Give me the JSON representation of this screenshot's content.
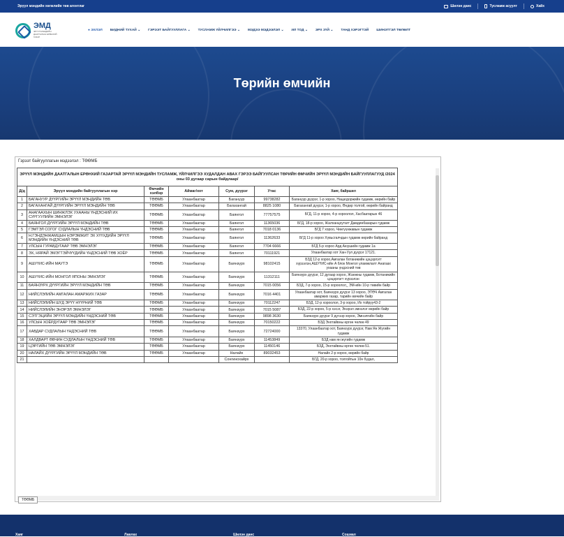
{
  "topbar": {
    "agency": "Эрүүл мэндийн хөгжлийн төв агентлаг",
    "links": [
      {
        "label": "Шилэн данс",
        "icon": "book-icon"
      },
      {
        "label": "Тусламж асуулт",
        "icon": "phone-icon"
      },
      {
        "label": "Хайх",
        "icon": "search-icon"
      }
    ]
  },
  "logo": {
    "name": "ЭМД",
    "subtitle": "ЭРҮҮЛ МЭНДИЙН ДААТГАЛЫН ЕРӨНХИЙ ГАЗАР"
  },
  "menu": [
    {
      "label": "ЭХЛЭЛ",
      "active": true
    },
    {
      "label": "БИДНИЙ ТУХАЙ ⌄"
    },
    {
      "label": "ГЭРЭЭТ БАЙГУУЛЛАГА ⌄"
    },
    {
      "label": "ТУСЛАМЖ ҮЙЛЧИЛГЭЭ ⌄"
    },
    {
      "label": "МЭДЭЭ МЭДЭЭЛЭЛ ⌄"
    },
    {
      "label": "ИЛ ТОД ⌄"
    },
    {
      "label": "ЭРХ ЗҮЙ ⌄"
    },
    {
      "label": "ТАНД ХЭРЭГТЭЙ"
    },
    {
      "label": "ШИНЭТГЭЛ ТӨЛӨЛТ"
    }
  ],
  "hero": {
    "title": "Төрийн өмчийн"
  },
  "panel": {
    "title": "Гэрээт байгууллагын мэдээлэл : ТӨӨМБ",
    "tab": "ТӨӨМБ",
    "heading_prefix": "ЭРҮҮЛ МЭНДИЙН ДААТГАЛЫН ЕРӨНХИЙ ГАЗАРТАЙ ЭРҮҮЛ МЭНДИЙН ТУСЛАМЖ, ҮЙЛЧИЛГЭЭ ХУДАЛДАН АВАХ ГЭРЭЭ БАЙГУУЛСАН ",
    "heading_bold": "ТӨРИЙН ӨМЧИЙН",
    "heading_suffix": " ЭРҮҮЛ МЭНДИЙН БАЙГУУЛЛАГУУД /2024 оны 03 дугаар сарын байдлаар/",
    "columns": [
      "Д/д",
      "Эрүүл мэндийн байгууллагын нэр",
      "Өмчийн хэлбэр",
      "Аймаг/хот",
      "Сум, дүүрэг",
      "Утас",
      "Хаяг, байршил"
    ],
    "rows": [
      [
        "1",
        "БАГАНУУР ДҮҮРГИЙН ЭРҮҮЛ МЭНДИЙН ТӨВ",
        "ТӨӨМБ",
        "Улаанбаатар",
        "Багануур",
        "99738282",
        "Багануур дүүрэг, 1-р хороо, Нацагдоржийн гудамж, өөрийн байр"
      ],
      [
        "2",
        "БАГАХАНГАЙ ДҮҮРГИЙН ЭРҮҮЛ МЭНДИЙН ТӨВ",
        "ТӨӨМБ",
        "Улаанбаатар",
        "Багахангай",
        "8825 1080",
        "Багахангай дүүрэг, 1-р хороо, Өндөр толгой, өөрийн байранд"
      ],
      [
        "3",
        "АНАГААХЫН ШИНЖЛЭХ УХААНЫ ҮНДЭСНИЙ ИХ СУРГУУЛИЙН ЭМНЭЛЭГ",
        "ТӨӨМБ",
        "Улаанбаатар",
        "Баянгол",
        "77757575",
        "БГД, 11-р хороо, 4-р хороолол, Хасбаатарын 46"
      ],
      [
        "4",
        "БАЯНГОЛ ДҮҮРГИЙН ЭРҮҮЛ МЭНДИЙН ТӨВ",
        "ТӨӨМБ",
        "Улаанбаатар",
        "Баянгол",
        "11365036",
        "БГД, 18-р хороо, Жалханцхутагт Дамдинбазарын гудамж"
      ],
      [
        "5",
        "ГЭМТЭЛ СОГОГ СУДЛАЛЫН ҮНДЭСНИЙ ТӨВ",
        "ТӨӨМБ",
        "Улаанбаатар",
        "Баянгол",
        "7018 0136",
        "БГД 7 хороо, Чингүүнжавын гудамж"
      ],
      [
        "6",
        "Н.ГЭНДЭНЖАМЦЫН НЭРЭМЖИТ ЭХ ХҮҮХДИЙН ЭРҮҮЛ МЭНДИЙН ҮНДЭСНИЙ ТӨВ",
        "ТӨӨМБ",
        "Улаанбаатар",
        "Баянгол",
        "11362633",
        "БГД 11-р хороо Хүвьсгалчдын гудамж өөрийн байранд"
      ],
      [
        "7",
        "УЛСЫН ГУРАВДУГААР ТӨВ ЭМНЭЛЭГ",
        "ТӨӨМБ",
        "Улаанбаатар",
        "Баянгол",
        "7704 6666",
        "БГД 5-р хороо Ард Аюушийн гудамж 1а"
      ],
      [
        "8",
        "ЭХ, НЯРАЙ ЭМЭГТЭЙЧҮҮДИЙН ҮНДЭСНИЙ ТӨВ ХОЁР",
        "ТӨӨМБ",
        "Улаанбаатар",
        "Баянгол",
        "70111921",
        "Улаанбаатар хот Хан-Уул дүүрэг 17121."
      ],
      [
        "9",
        "АШУҮИС-ИЙН МАУТЭ",
        "ТӨӨМБ",
        "Улаанбаатар",
        "Баянзүрх",
        "98102415",
        "БЗД 12-р хороо,Амгалан ботаникийн цэцэрлэгт хүрээлэн,АШУҮИС-ийн А блок Монгол уламжлалт Анагаах ухааны үндэсний төв"
      ],
      [
        "10",
        "АШУҮИС-ИЙН МОНГОЛ ЯПОНЫ ЭМНЭЛЭГ",
        "ТӨӨМБ",
        "Улаанбаатар",
        "Баянзүрх",
        "11312111",
        "Баянзүрх дүүрэг, 12 дугаар хороо, Жанжны гудамж, Ботаникийн цэцэрлэгт хүрээлэн"
      ],
      [
        "11",
        "БАЯНЗҮРХ ДҮҮРГИЙН ЭРҮҮЛ МЭНДИЙН ТӨВ",
        "ТӨӨМБ",
        "Улаанбаатар",
        "Баянзүрх",
        "7015 0056",
        "БЗД, 7-р хороо, 15-р хороолол_ ЭМ-ийн 10-р төвийн байр"
      ],
      [
        "12",
        "НИЙСЛЭЛИЙН АМГАЛАН АМАРЖИХ ГАЗАР",
        "ТӨӨМБ",
        "Улаанбаатар",
        "Баянзүрх",
        "7016 4401",
        "Улаанбаатар хот, Баянзүрх дүүрэг 13 хороо, ЭТӨЧ Амгалан амаржих газар, тарийн өмчийн байр"
      ],
      [
        "13",
        "НИЙСЛЭЛИЙН ШҮД ЭРҮҮ НҮҮРНИЙ ТӨВ",
        "ТӨӨМБ",
        "Улаанбаатар",
        "Баянзүрх",
        "70112247",
        "БЗД, 12-р хороолол, 3-р хороо, Их тойруу43-2"
      ],
      [
        "14",
        "НИЙСЛЭЛИЙН ЭНЭРЭЛ ЭМНЭЛЭГ",
        "ТӨӨМБ",
        "Улаанбаатар",
        "Баянзүрх",
        "7015 5087",
        "БЗД, 22-р хороо, 5-р хэсэг, Энэрэл эмнэлэг өөрийн байр"
      ],
      [
        "15",
        "СЭТГЭЦИЙН ЭРҮҮЛ МЭНДИЙН ҮНДЭСНИЙ ТӨВ",
        "ТӨӨМБ",
        "Улаанбаатар",
        "Баянзүрх",
        "9898 3630",
        "Баянзүрх дүүрэг 9 дүгээр хороо, Эмнэлгийн байр"
      ],
      [
        "16",
        "УЛСЫН ХОЁРДУГААР ТӨВ ЭМНЭЛЭГ",
        "ТӨӨМБ",
        "Улаанбаатар",
        "Баянзүрх",
        "70150222",
        "БЗД Энхтайвны өргөн чөлөө 49"
      ],
      [
        "17",
        "ХАВДАР СУДЛАЛЫН ҮНДЭСНИЙ ТӨВ",
        "ТӨӨМБ",
        "Улаанбаатар",
        "Баянзүрх",
        "72724000",
        "13370, Улаанбаатар хот, Баянзүрх дүүрэг, Нам Ян Жүгийн гудамж"
      ],
      [
        "18",
        "ХАЛДВАРТ ӨВЧИН СУДЛАЛЫН ҮНДЭСНИЙ ТӨВ",
        "ТӨӨМБ",
        "Улаанбаатар",
        "Баянзүрх",
        "11453849",
        "БЗД нам ян жүгийн гудамж"
      ],
      [
        "19",
        "ЦЭРГИЙН ТӨВ ЭМНЭЛЭГ",
        "ТӨӨМБ",
        "Улаанбаатар",
        "Баянзүрх",
        "11450146",
        "БЗД, Энхтайвны өргөн чөлөө-51."
      ],
      [
        "20",
        "НАЛАЙХ ДҮҮРГИЙН ЭРҮҮЛ МЭНДИЙН ТӨВ",
        "ТӨӨМБ",
        "Улаанбаатар",
        "Налайх",
        "89032453",
        "Налайх 2-р хороо, өөрийн байр"
      ],
      [
        "21",
        "",
        "",
        "",
        "Сонгинохайрх",
        "",
        "БГД, 20-р хороо, толгойтын 10н бүдал,"
      ]
    ]
  },
  "footer": {
    "headings": [
      "Хаяг",
      "Лавлах",
      "Шилэн данс",
      "Сошиал"
    ]
  }
}
